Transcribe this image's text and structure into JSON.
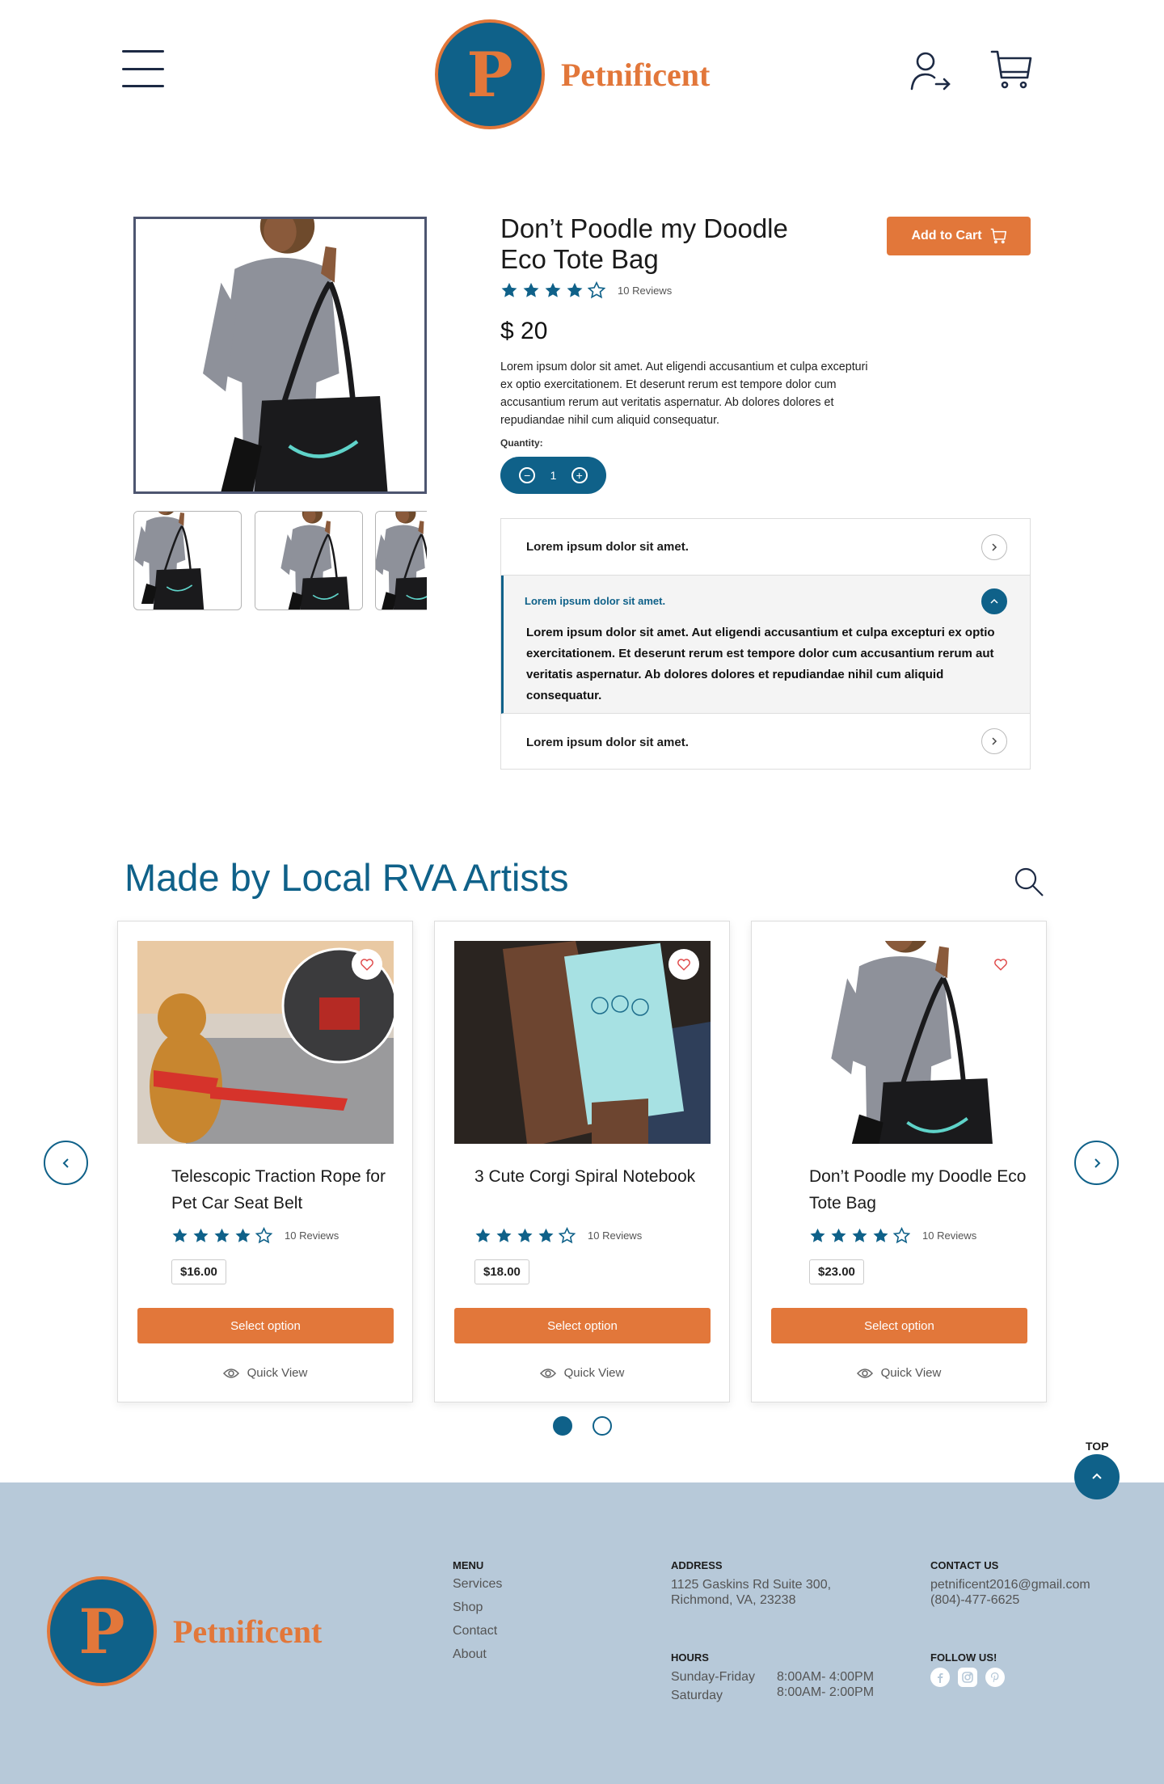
{
  "brand": {
    "name": "Petnificent",
    "initial": "P"
  },
  "colors": {
    "primary": "#0f6189",
    "accent": "#e2773a",
    "footer_bg": "#b7c9d9"
  },
  "header": {
    "menu_icon": "hamburger-icon",
    "account_icon": "account-login-icon",
    "cart_icon": "cart-icon"
  },
  "product": {
    "title_line1": "Don’t Poodle my Doodle",
    "title_line2": "Eco Tote Bag",
    "rating": 4,
    "max_rating": 5,
    "reviews": "10 Reviews",
    "price": "$ 20",
    "description": "Lorem ipsum dolor sit amet. Aut eligendi accusantium et culpa excepturi ex optio exercitationem. Et deserunt rerum est tempore dolor cum accusantium rerum aut veritatis aspernatur. Ab dolores dolores et repudiandae nihil cum aliquid consequatur.",
    "quantity_label": "Quantity:",
    "quantity": "1",
    "add_to_cart": "Add to Cart"
  },
  "accordion": [
    {
      "title": "Lorem ipsum dolor sit amet.",
      "open": false
    },
    {
      "title": "Lorem ipsum dolor sit amet.",
      "open": true,
      "body": "Lorem ipsum dolor sit amet. Aut eligendi accusantium et culpa excepturi ex optio exercitationem. Et deserunt rerum est tempore dolor cum accusantium rerum aut veritatis aspernatur. Ab dolores dolores et repudiandae nihil cum aliquid consequatur."
    },
    {
      "title": "Lorem ipsum dolor sit amet.",
      "open": false
    }
  ],
  "artists": {
    "title": "Made by Local RVA Artists",
    "cards": [
      {
        "title": "Telescopic Traction Rope for Pet Car Seat Belt",
        "rating": 4,
        "reviews": "10 Reviews",
        "price": "$16.00",
        "button": "Select option",
        "quick_view": "Quick View"
      },
      {
        "title": "3 Cute Corgi Spiral Notebook",
        "rating": 4,
        "reviews": "10 Reviews",
        "price": "$18.00",
        "button": "Select option",
        "quick_view": "Quick View"
      },
      {
        "title": "Don’t Poodle my Doodle Eco Tote Bag",
        "rating": 4,
        "reviews": "10 Reviews",
        "price": "$23.00",
        "button": "Select option",
        "quick_view": "Quick View"
      }
    ],
    "pagination": {
      "pages": 2,
      "active": 1
    }
  },
  "top_label": "TOP",
  "footer": {
    "menu_heading": "MENU",
    "menu": [
      "Services",
      "Shop",
      "Contact",
      "About"
    ],
    "address_heading": "ADDRESS",
    "address_line1": "1125 Gaskins Rd Suite 300,",
    "address_line2": "Richmond, VA, 23238",
    "hours_heading": "HOURS",
    "hours": [
      {
        "day": "Sunday-Friday",
        "time": "8:00AM- 4:00PM"
      },
      {
        "day": "Saturday",
        "time": "8:00AM- 2:00PM"
      }
    ],
    "contact_heading": "CONTACT US",
    "email": "petnificent2016@gmail.com",
    "phone": "(804)-477-6625",
    "follow_heading": "FOLLOW US!",
    "social": [
      "facebook-icon",
      "instagram-icon",
      "pinterest-icon"
    ]
  }
}
